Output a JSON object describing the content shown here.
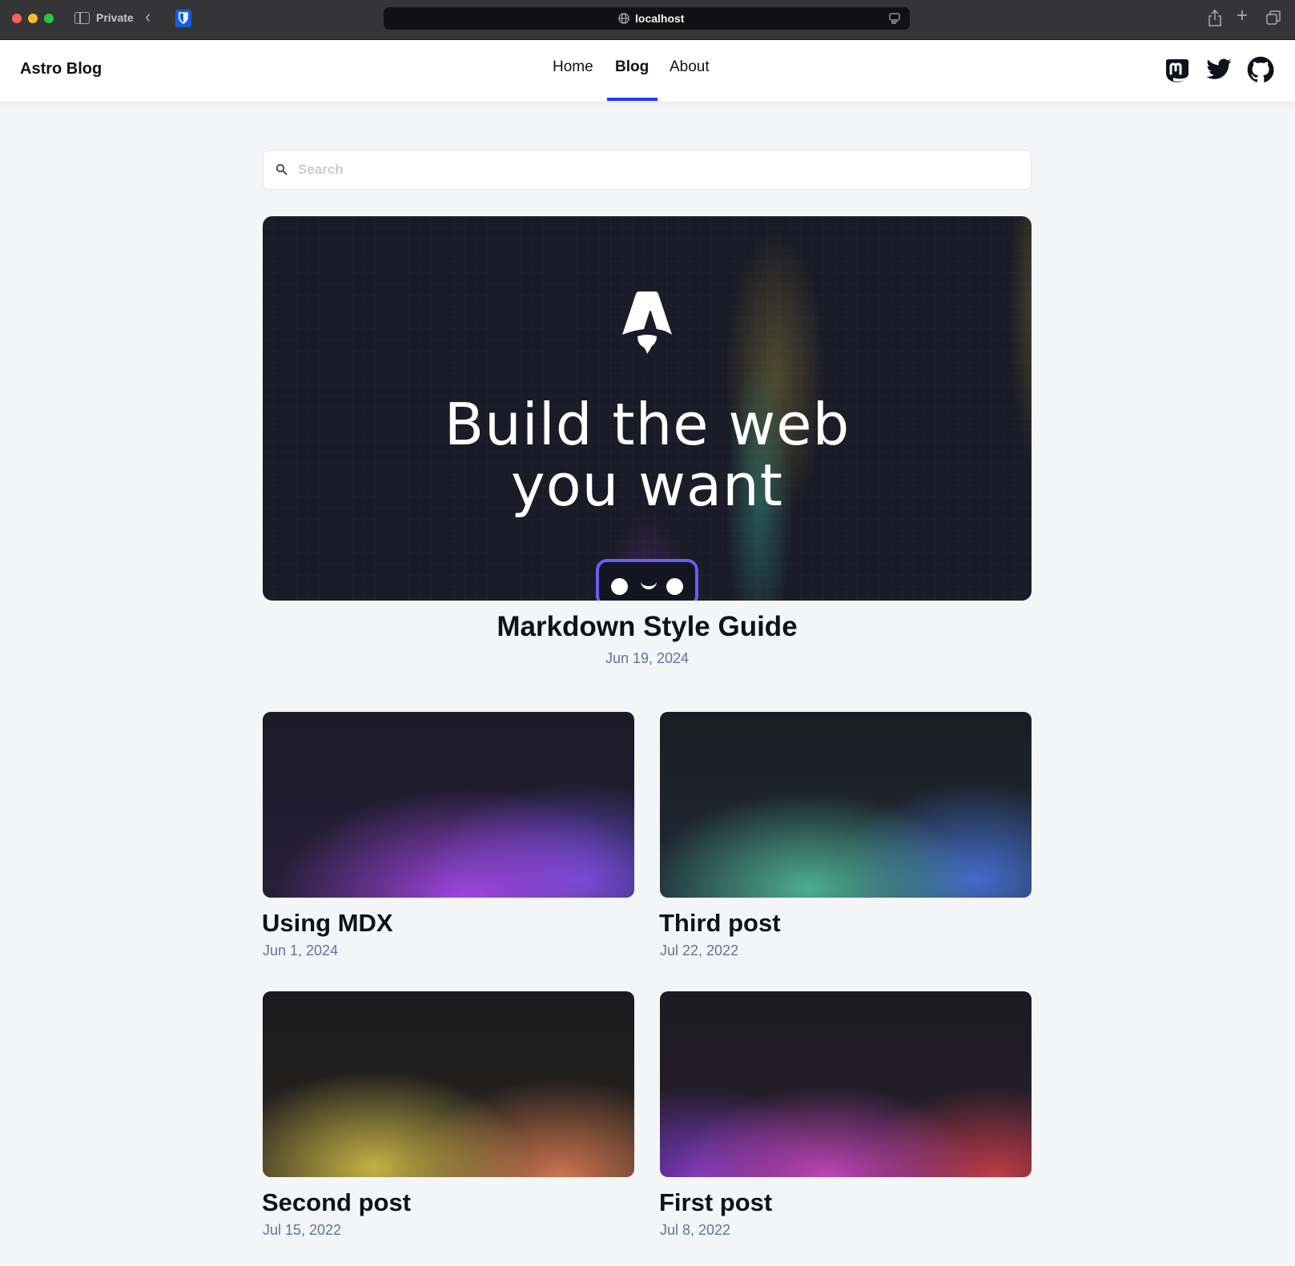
{
  "browser": {
    "private_label": "Private",
    "url": "localhost",
    "icons": [
      "sidebar-icon",
      "back-icon",
      "bitwarden-icon",
      "globe-icon",
      "reader-icon",
      "share-icon",
      "new-tab-icon",
      "tabs-icon"
    ]
  },
  "header": {
    "site_title": "Astro Blog",
    "nav": {
      "home": "Home",
      "blog": "Blog",
      "about": "About",
      "active": "Blog"
    },
    "social_icons": [
      "mastodon-icon",
      "twitter-icon",
      "github-icon"
    ],
    "accent_color": "#2337ff"
  },
  "search": {
    "placeholder": "Search",
    "value": ""
  },
  "featured": {
    "hero_heading_line1": "Build the web",
    "hero_heading_line2": "you want",
    "title": "Markdown Style Guide",
    "date": "Jun 19, 2024"
  },
  "posts": [
    {
      "title": "Using MDX",
      "date": "Jun 1, 2024"
    },
    {
      "title": "Third post",
      "date": "Jul 22, 2022"
    },
    {
      "title": "Second post",
      "date": "Jul 15, 2022"
    },
    {
      "title": "First post",
      "date": "Jul 8, 2022"
    }
  ],
  "colors": {
    "date_text": "#60739f",
    "page_background": "#f4f5f7"
  }
}
